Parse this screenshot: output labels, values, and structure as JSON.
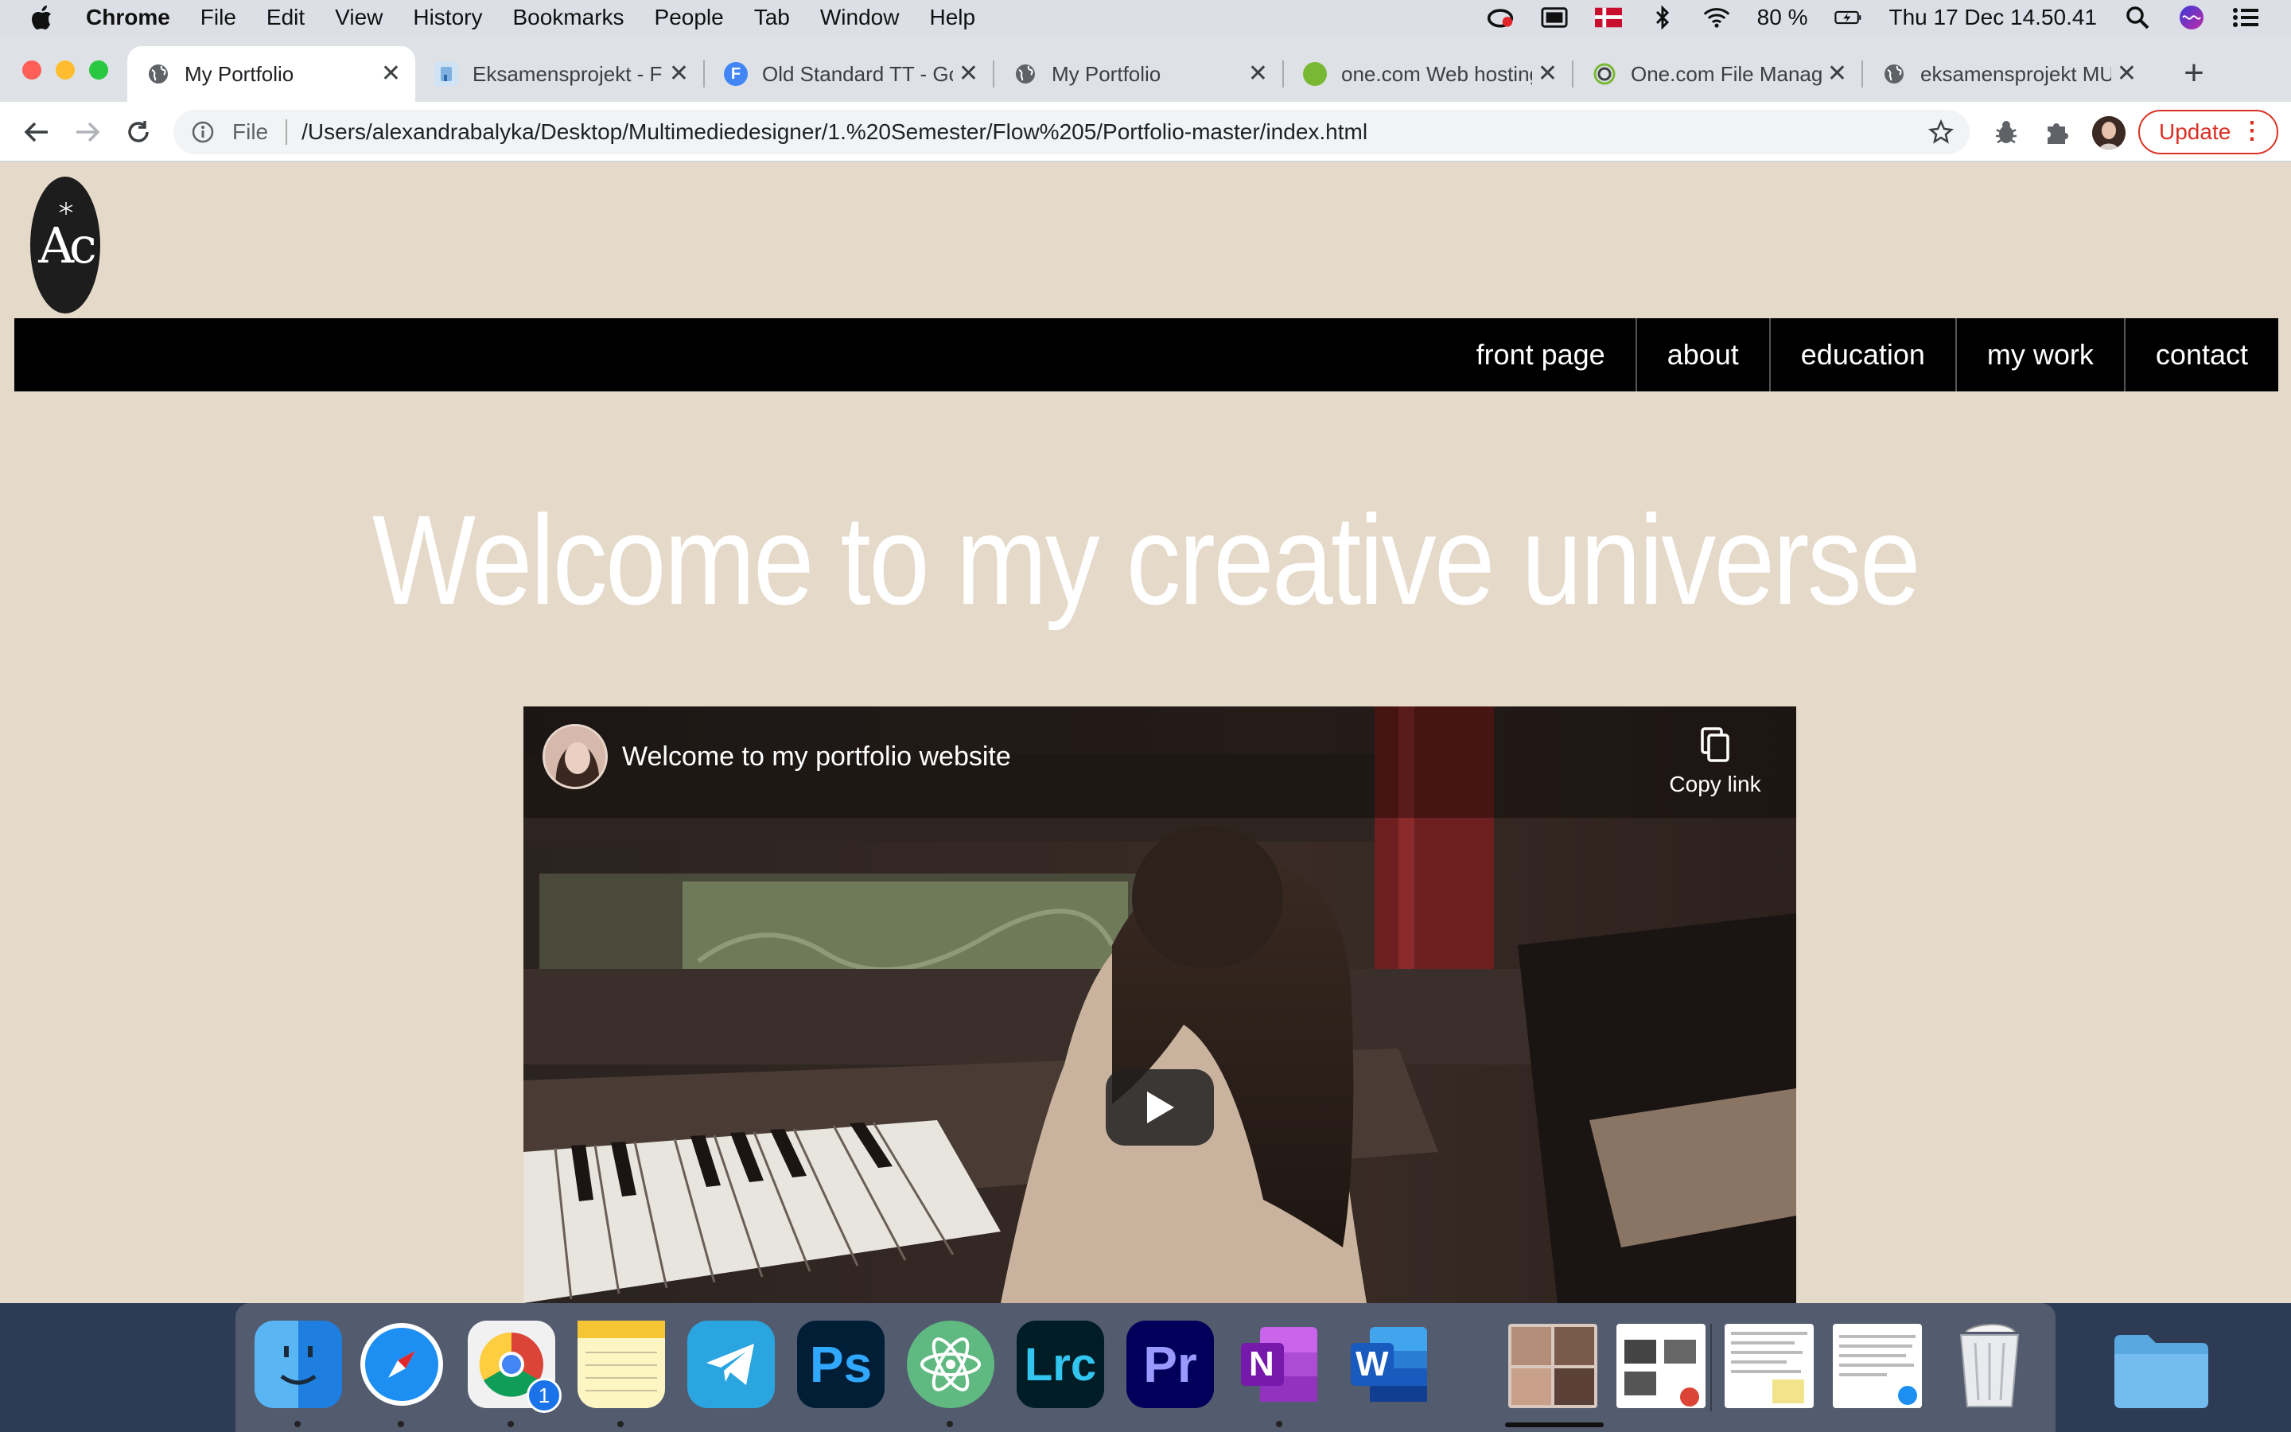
{
  "menubar": {
    "app": "Chrome",
    "items": [
      "File",
      "Edit",
      "View",
      "History",
      "Bookmarks",
      "People",
      "Tab",
      "Window",
      "Help"
    ],
    "battery": "80 %",
    "clock": "Thu 17 Dec  14.50.41"
  },
  "tabs": [
    {
      "label": "My Portfolio",
      "icon": "globe-icon",
      "active": true
    },
    {
      "label": "Eksamensprojekt - Fi",
      "icon": "figma-like-icon"
    },
    {
      "label": "Old Standard TT - Go",
      "icon": "fonts-icon",
      "fav_letter": "F"
    },
    {
      "label": "My Portfolio",
      "icon": "globe-icon"
    },
    {
      "label": "one.com Web hosting",
      "icon": "onecom-icon"
    },
    {
      "label": "One.com File Manage",
      "icon": "onecom-ring-icon"
    },
    {
      "label": "eksamensprojekt MU",
      "icon": "globe-icon"
    }
  ],
  "toolbar": {
    "scheme": "File",
    "url": "/Users/alexandrabalyka/Desktop/Multimediedesigner/1.%20Semester/Flow%205/Portfolio-master/index.html",
    "update_label": "Update"
  },
  "site": {
    "logo_text": "Ac",
    "nav": [
      "front page",
      "about",
      "education",
      "my work",
      "contact"
    ],
    "headline": "Welcome to my creative universe",
    "video": {
      "title": "Welcome to my portfolio website",
      "copy_label": "Copy link"
    }
  },
  "dock": {
    "apps": [
      "finder",
      "safari",
      "chrome",
      "notes",
      "telegram",
      "photoshop",
      "atom",
      "lightroom-classic",
      "premiere-pro",
      "onenote",
      "word"
    ],
    "chrome_badge": "1",
    "ps_label": "Ps",
    "lrc_label": "Lrc",
    "pr_label": "Pr",
    "onenote_label": "N",
    "word_label": "W"
  },
  "colors": {
    "page_bg": "#e5d9c9",
    "nav_bg": "#000000",
    "update": "#d93025"
  }
}
